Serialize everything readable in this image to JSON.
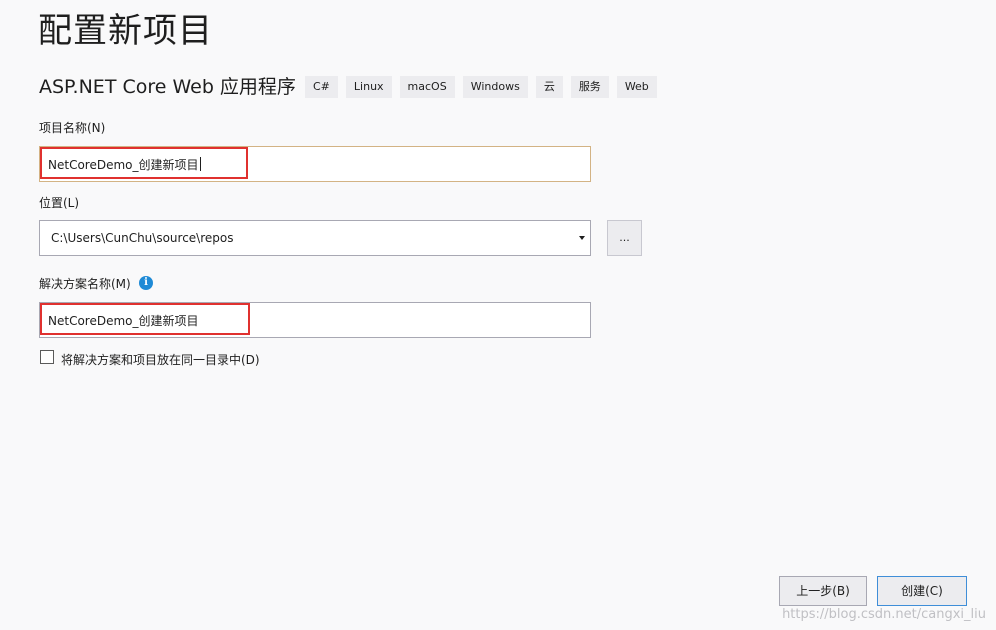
{
  "page": {
    "title": "配置新项目"
  },
  "template": {
    "name": "ASP.NET Core Web 应用程序",
    "tags": [
      "C#",
      "Linux",
      "macOS",
      "Windows",
      "云",
      "服务",
      "Web"
    ]
  },
  "project_name": {
    "label": "项目名称(N)",
    "value": "NetCoreDemo_创建新项目"
  },
  "location": {
    "label": "位置(L)",
    "value": "C:\\Users\\CunChu\\source\\repos",
    "browse_label": "..."
  },
  "solution_name": {
    "label": "解决方案名称(M)",
    "value": "NetCoreDemo_创建新项目"
  },
  "same_dir_checkbox": {
    "label": "将解决方案和项目放在同一目录中(D)",
    "checked": false
  },
  "footer": {
    "back_label": "上一步(B)",
    "create_label": "创建(C)"
  },
  "watermark": "https://blog.csdn.net/cangxi_liu",
  "colors": {
    "highlight": "#e0312f",
    "info": "#1e8ad6",
    "focus_border": "#d3b384",
    "primary_border": "#3f8ed8"
  }
}
